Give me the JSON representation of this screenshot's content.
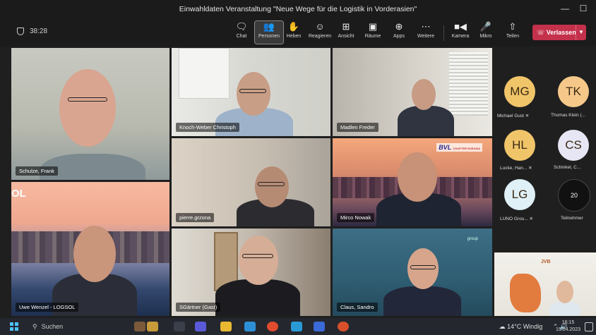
{
  "window": {
    "title": "Einwahldaten Veranstaltung \"Neue Wege für die Logistik in Vorderasien\"",
    "minimize": "—",
    "maximize": "☐"
  },
  "toolbar": {
    "timer": "38:28",
    "buttons": [
      {
        "label": "Chat",
        "icon": "chat-icon"
      },
      {
        "label": "Personen",
        "icon": "people-icon"
      },
      {
        "label": "Heben",
        "icon": "raise-hand-icon"
      },
      {
        "label": "Reagieren",
        "icon": "react-icon"
      },
      {
        "label": "Ansicht",
        "icon": "view-icon"
      },
      {
        "label": "Räume",
        "icon": "rooms-icon"
      },
      {
        "label": "Apps",
        "icon": "apps-icon"
      },
      {
        "label": "Weitere",
        "icon": "more-icon"
      },
      {
        "label": "Kamera",
        "icon": "camera-icon"
      },
      {
        "label": "Mikro",
        "icon": "mic-icon"
      },
      {
        "label": "Teilen",
        "icon": "share-icon"
      }
    ],
    "leave_label": "Verlassen"
  },
  "tiles": [
    {
      "name": "Schulze, Frank"
    },
    {
      "name": "Knoch-Weber Christoph"
    },
    {
      "name": "Madlen Freder"
    },
    {
      "name": "pierre.grzona"
    },
    {
      "name": "Mirco Nowak"
    },
    {
      "name": "Uwe Wenzel - LOGSOL"
    },
    {
      "name": "SGärtner (Gast)"
    },
    {
      "name": "Claus, Sandro"
    }
  ],
  "tile_overlays": {
    "logsol_text": "OL",
    "bvl_logo": "BVL",
    "bvl_sub": "CHAPTER EURASIA",
    "group_logo": "group",
    "jvb_logo": "JVB"
  },
  "avatars": [
    {
      "initials": "MG",
      "name": "Michael Gust",
      "color": "#f0c56a"
    },
    {
      "initials": "TK",
      "name": "Thomas Klein (...",
      "color": "#f5c88a"
    },
    {
      "initials": "HL",
      "name": "Lucke, Han...",
      "color": "#f0c56a"
    },
    {
      "initials": "CS",
      "name": "Schinkel, C...",
      "color": "#e6e6f5"
    },
    {
      "initials": "LG",
      "name": "LUNO Grou...",
      "color": "#dff0f7"
    },
    {
      "initials": "20",
      "name": "Teilnehmer",
      "color": "#111111"
    }
  ],
  "taskbar": {
    "search_label": "Suchen",
    "weather": "14°C Windig",
    "time": "16:15",
    "date": "19.04.2023"
  }
}
